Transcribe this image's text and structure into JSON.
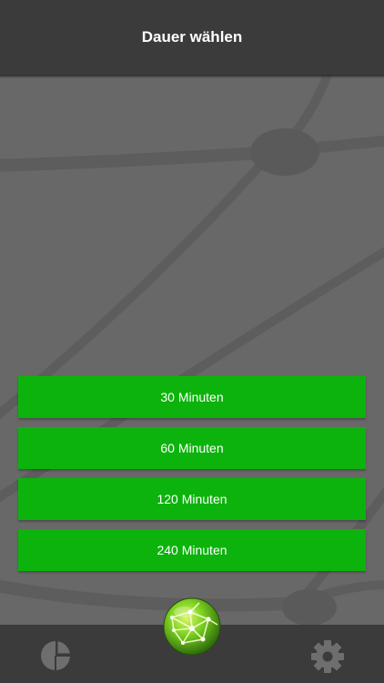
{
  "header": {
    "title": "Dauer wählen"
  },
  "durations": [
    {
      "label": "30 Minuten"
    },
    {
      "label": "60 Minuten"
    },
    {
      "label": "120 Minuten"
    },
    {
      "label": "240 Minuten"
    }
  ],
  "bottom_nav": {
    "left_icon": "pie-chart-icon",
    "center_icon": "globe-network-icon",
    "right_icon": "gear-icon"
  },
  "colors": {
    "header_bg": "#3b3b3b",
    "background": "#686868",
    "button_green": "#0cb30c",
    "icon_gray": "#6e6e6e",
    "globe_green": "#7ed321"
  }
}
